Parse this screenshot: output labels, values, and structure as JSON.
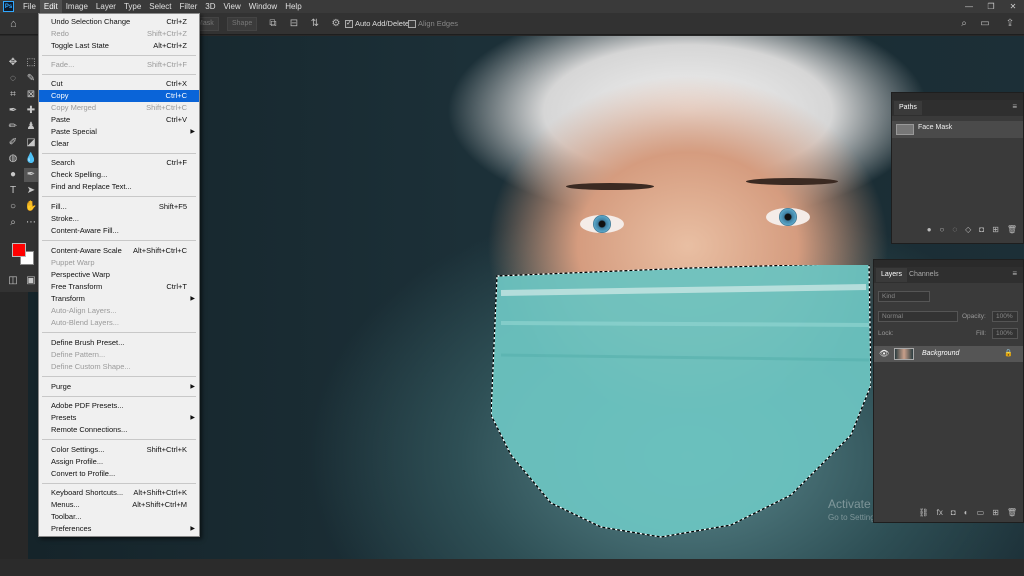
{
  "menubar": {
    "logo": "Ps",
    "items": [
      "File",
      "Edit",
      "Image",
      "Layer",
      "Type",
      "Select",
      "Filter",
      "3D",
      "View",
      "Window",
      "Help"
    ],
    "window_controls": [
      "—",
      "❐",
      "✕"
    ]
  },
  "optionsbar": {
    "mask_label": "Mask",
    "shape_label": "Shape",
    "auto_add_delete_label": "Auto Add/Delete",
    "auto_add_delete_checked": true,
    "align_edges_label": "Align Edges",
    "align_edges_checked": false
  },
  "colors": {
    "foreground": "#ff0000",
    "background": "#ffffff",
    "highlight": "#0a64d8"
  },
  "edit_menu": {
    "items": [
      {
        "label": "Undo Selection Change",
        "shortcut": "Ctrl+Z",
        "disabled": false
      },
      {
        "label": "Redo",
        "shortcut": "Shift+Ctrl+Z",
        "disabled": true
      },
      {
        "label": "Toggle Last State",
        "shortcut": "Alt+Ctrl+Z",
        "disabled": false
      },
      {
        "label": "Fade...",
        "shortcut": "Shift+Ctrl+F",
        "disabled": true
      },
      {
        "label": "Cut",
        "shortcut": "Ctrl+X",
        "disabled": false
      },
      {
        "label": "Copy",
        "shortcut": "Ctrl+C",
        "disabled": false,
        "highlighted": true
      },
      {
        "label": "Copy Merged",
        "shortcut": "Shift+Ctrl+C",
        "disabled": true
      },
      {
        "label": "Paste",
        "shortcut": "Ctrl+V",
        "disabled": false
      },
      {
        "label": "Paste Special",
        "shortcut": "",
        "disabled": false,
        "submenu": true
      },
      {
        "label": "Clear",
        "shortcut": "",
        "disabled": false
      },
      {
        "label": "Search",
        "shortcut": "Ctrl+F",
        "disabled": false
      },
      {
        "label": "Check Spelling...",
        "shortcut": "",
        "disabled": false
      },
      {
        "label": "Find and Replace Text...",
        "shortcut": "",
        "disabled": false
      },
      {
        "label": "Fill...",
        "shortcut": "Shift+F5",
        "disabled": false
      },
      {
        "label": "Stroke...",
        "shortcut": "",
        "disabled": false
      },
      {
        "label": "Content-Aware Fill...",
        "shortcut": "",
        "disabled": false
      },
      {
        "label": "Content-Aware Scale",
        "shortcut": "Alt+Shift+Ctrl+C",
        "disabled": false
      },
      {
        "label": "Puppet Warp",
        "shortcut": "",
        "disabled": true
      },
      {
        "label": "Perspective Warp",
        "shortcut": "",
        "disabled": false
      },
      {
        "label": "Free Transform",
        "shortcut": "Ctrl+T",
        "disabled": false
      },
      {
        "label": "Transform",
        "shortcut": "",
        "disabled": false,
        "submenu": true
      },
      {
        "label": "Auto-Align Layers...",
        "shortcut": "",
        "disabled": true
      },
      {
        "label": "Auto-Blend Layers...",
        "shortcut": "",
        "disabled": true
      },
      {
        "label": "Define Brush Preset...",
        "shortcut": "",
        "disabled": false
      },
      {
        "label": "Define Pattern...",
        "shortcut": "",
        "disabled": true
      },
      {
        "label": "Define Custom Shape...",
        "shortcut": "",
        "disabled": true
      },
      {
        "label": "Purge",
        "shortcut": "",
        "disabled": false,
        "submenu": true
      },
      {
        "label": "Adobe PDF Presets...",
        "shortcut": "",
        "disabled": false
      },
      {
        "label": "Presets",
        "shortcut": "",
        "disabled": false,
        "submenu": true
      },
      {
        "label": "Remote Connections...",
        "shortcut": "",
        "disabled": false
      },
      {
        "label": "Color Settings...",
        "shortcut": "Shift+Ctrl+K",
        "disabled": false
      },
      {
        "label": "Assign Profile...",
        "shortcut": "",
        "disabled": false
      },
      {
        "label": "Convert to Profile...",
        "shortcut": "",
        "disabled": false
      },
      {
        "label": "Keyboard Shortcuts...",
        "shortcut": "Alt+Shift+Ctrl+K",
        "disabled": false
      },
      {
        "label": "Menus...",
        "shortcut": "Alt+Shift+Ctrl+M",
        "disabled": false
      },
      {
        "label": "Toolbar...",
        "shortcut": "",
        "disabled": false
      },
      {
        "label": "Preferences",
        "shortcut": "",
        "disabled": false,
        "submenu": true
      }
    ]
  },
  "paths_panel": {
    "tab": "Paths",
    "path_name": "Face Mask"
  },
  "layers_panel": {
    "tabs": [
      "Layers",
      "Channels"
    ],
    "kind_placeholder": "Kind",
    "blend_mode": "Normal",
    "opacity_label": "Opacity:",
    "opacity_value": "100%",
    "lock_label": "Lock:",
    "fill_label": "Fill:",
    "fill_value": "100%",
    "layer_name": "Background"
  },
  "watermark": {
    "title": "Activate Windows",
    "subtitle": "Go to Settings to activate Windows."
  }
}
